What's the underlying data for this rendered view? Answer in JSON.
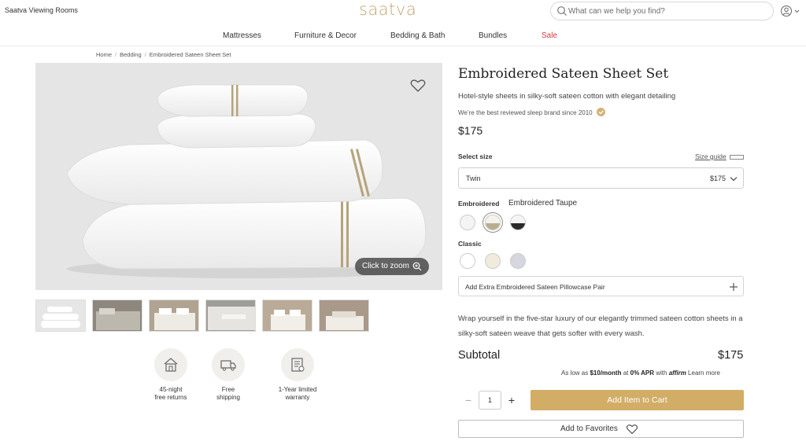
{
  "header": {
    "viewing_rooms": "Saatva Viewing Rooms",
    "logo": "saatva",
    "search_placeholder": "What can we help you find?",
    "account_icon": "user-circle-icon"
  },
  "nav": {
    "items": [
      "Mattresses",
      "Furniture & Decor",
      "Bedding & Bath",
      "Bundles",
      "Sale"
    ],
    "sale_color": "#d13a3a"
  },
  "breadcrumb": [
    "Home",
    "Bedding",
    "Embroidered Sateen Sheet Set"
  ],
  "gallery": {
    "zoom_label": "Click to zoom",
    "thumbnail_count": 6
  },
  "perks": [
    {
      "icon": "house-icon",
      "line1": "45-night",
      "line2": "free returns"
    },
    {
      "icon": "truck-icon",
      "line1": "Free",
      "line2": "shipping"
    },
    {
      "icon": "warranty-icon",
      "line1": "1-Year limited",
      "line2": "warranty"
    }
  ],
  "product": {
    "title": "Embroidered Sateen Sheet Set",
    "subtitle": "Hotel-style sheets in silky-soft sateen cotton with elegant detailing",
    "brand_claim": "We’re the best reviewed sleep brand since 2010",
    "price": "$175",
    "size_label": "Select size",
    "size_guide": "Size guide",
    "size_selected": "Twin",
    "size_price": "$175",
    "embroidered_label": "Embroidered",
    "selected_color": "Embroidered Taupe",
    "classic_label": "Classic",
    "addon": "Add Extra Embroidered Sateen Pillowcase Pair",
    "description": "Wrap yourself in the five-star luxury of our elegantly trimmed sateen cotton sheets in a silky-soft sateen weave that gets softer with every wash.",
    "subtotal_label": "Subtotal",
    "subtotal_value": "$175",
    "finance_prefix": "As low as",
    "finance_amount": "$10/month",
    "finance_at": "at",
    "finance_apr": "0% APR",
    "finance_with": "with",
    "finance_brand": "affirm",
    "finance_learn": "Learn more",
    "quantity": "1",
    "add_to_cart": "Add Item to Cart",
    "add_to_favorites": "Add to Favorites"
  },
  "colors": {
    "brand_gold": "#c4a472",
    "cart_button": "#d2ad66",
    "embroidered_swatches": [
      "#f4f4f4",
      "#cfc6ad",
      "#2a2a2a"
    ],
    "classic_swatches": [
      "#ffffff",
      "#f1ebdc",
      "#d6d7de"
    ]
  }
}
